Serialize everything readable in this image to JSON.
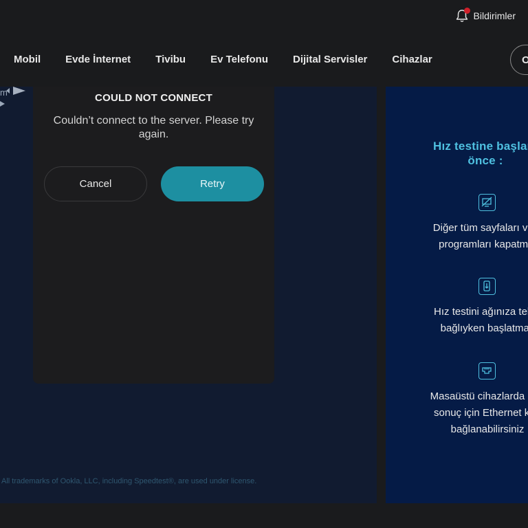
{
  "header": {
    "notifications_label": "Bildirimler"
  },
  "nav": {
    "items": [
      {
        "label": "Mobil"
      },
      {
        "label": "Evde İnternet"
      },
      {
        "label": "Tivibu"
      },
      {
        "label": "Ev Telefonu"
      },
      {
        "label": "Dijital Servisler"
      },
      {
        "label": "Cihazlar"
      }
    ],
    "pill_label": "O"
  },
  "deco": {
    "text": "m"
  },
  "modal": {
    "title": "COULD NOT CONNECT",
    "message": "Couldn’t connect to the server. Please try again.",
    "cancel_label": "Cancel",
    "retry_label": "Retry"
  },
  "footer": {
    "trademark": "All trademarks of Ookla, LLC, including Speedtest®, are used under license."
  },
  "tips": {
    "title_line1": "Hız testine başlam",
    "title_line2": "önce :",
    "items": [
      {
        "icon": "monitor-off-icon",
        "line1": "Diğer tüm sayfaları ve d",
        "line2": "programları kapatmal"
      },
      {
        "icon": "phone-download-icon",
        "line1": "Hız testini ağınıza tek b",
        "line2": "bağlıyken başlatmalı"
      },
      {
        "icon": "ethernet-port-icon",
        "line1": "Masaüstü cihazlarda dah",
        "line2": "sonuç için Ethernet kab",
        "line3": "bağlanabilirsiniz"
      }
    ]
  },
  "colors": {
    "accent": "#1d8fa1",
    "tip_title": "#4fc0e0",
    "notification_dot": "#d0202a",
    "panel_bg": "#051b46",
    "main_bg": "#111b30"
  }
}
